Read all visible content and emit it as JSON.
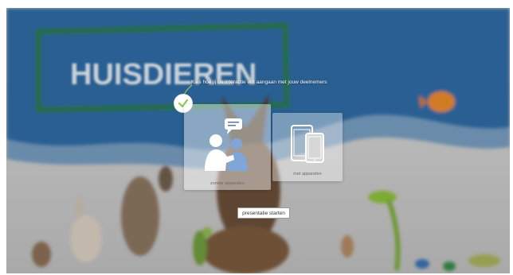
{
  "background": {
    "title_text": "HUISDIEREN",
    "sky_color": "#2e6aa3",
    "board_color": "#2c7a4a"
  },
  "dialog": {
    "hint": "Kies hoe jij de interactie wilt aangaan met jouw deelnemers",
    "accent_color": "#8fc84b",
    "options": [
      {
        "icon": "people-chat-icon",
        "label": "zonder apparaten",
        "selected": true
      },
      {
        "icon": "devices-icon",
        "label": "met apparaten",
        "selected": false
      }
    ],
    "start_label": "presentatie starten"
  }
}
